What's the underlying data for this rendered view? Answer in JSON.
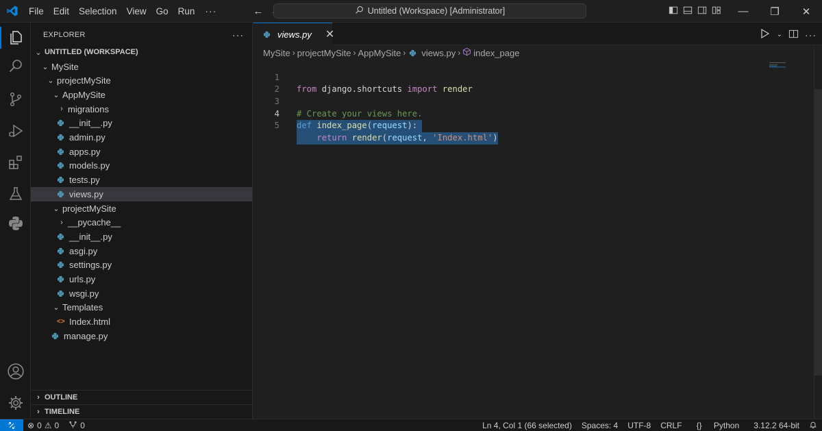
{
  "title_bar": {
    "menu": [
      "File",
      "Edit",
      "Selection",
      "View",
      "Go",
      "Run"
    ],
    "more": "···",
    "back_arrow": "←",
    "forward_arrow": "→",
    "command_center": "Untitled (Workspace) [Administrator]",
    "window_controls": {
      "minimize": "—",
      "restore": "❐",
      "close": "✕"
    }
  },
  "activity_bar": {
    "items": [
      "explorer",
      "search",
      "source-control",
      "run-and-debug",
      "extensions",
      "testing",
      "python"
    ],
    "bottom": [
      "accounts",
      "manage"
    ]
  },
  "sidebar": {
    "title": "EXPLORER",
    "more": "···",
    "workspace": "UNTITLED (WORKSPACE)",
    "tree": [
      {
        "label": "MySite",
        "type": "folder-open"
      },
      {
        "label": "projectMySite",
        "type": "folder-open"
      },
      {
        "label": "AppMySite",
        "type": "folder-open"
      },
      {
        "label": "migrations",
        "type": "folder-closed"
      },
      {
        "label": "__init__.py",
        "type": "py"
      },
      {
        "label": "admin.py",
        "type": "py"
      },
      {
        "label": "apps.py",
        "type": "py"
      },
      {
        "label": "models.py",
        "type": "py"
      },
      {
        "label": "tests.py",
        "type": "py"
      },
      {
        "label": "views.py",
        "type": "py",
        "selected": true
      },
      {
        "label": "projectMySite",
        "type": "folder-open"
      },
      {
        "label": "__pycache__",
        "type": "folder-closed"
      },
      {
        "label": "__init__.py",
        "type": "py"
      },
      {
        "label": "asgi.py",
        "type": "py"
      },
      {
        "label": "settings.py",
        "type": "py"
      },
      {
        "label": "urls.py",
        "type": "py"
      },
      {
        "label": "wsgi.py",
        "type": "py"
      },
      {
        "label": "Templates",
        "type": "folder-open"
      },
      {
        "label": "Index.html",
        "type": "html"
      },
      {
        "label": "manage.py",
        "type": "py"
      }
    ],
    "outline": "OUTLINE",
    "timeline": "TIMELINE"
  },
  "editor": {
    "tab": {
      "label": "views.py",
      "close": "✕"
    },
    "actions": {
      "more": "···"
    },
    "breadcrumb": [
      "MySite",
      "projectMySite",
      "AppMySite",
      "views.py",
      "index_page"
    ],
    "line_numbers": [
      "1",
      "2",
      "3",
      "4",
      "5"
    ],
    "code": {
      "l1": {
        "kw": "from",
        "mod": " django.shortcuts ",
        "kw2": "import",
        "fn": " render"
      },
      "l3": {
        "comment": "# Create your views here."
      },
      "l4": {
        "kw": "def",
        "fn": "index_page",
        "open": "(",
        "param": "request",
        "close": "):"
      },
      "l5": {
        "ws": "····",
        "kw": "return",
        "fn": "render",
        "open": "(",
        "param": "request",
        "comma": ", ",
        "str": "'Index.html'",
        "close": ")"
      }
    }
  },
  "status_bar": {
    "errors": "0",
    "warnings": "0",
    "ports": "0",
    "cursor": "Ln 4, Col 1 (66 selected)",
    "spaces": "Spaces: 4",
    "encoding": "UTF-8",
    "eol": "CRLF",
    "language": "Python",
    "interpreter": "3.12.2 64-bit"
  },
  "colors": {
    "accent": "#0078d4",
    "python_icon": "#519aba",
    "selection": "#264f78"
  }
}
